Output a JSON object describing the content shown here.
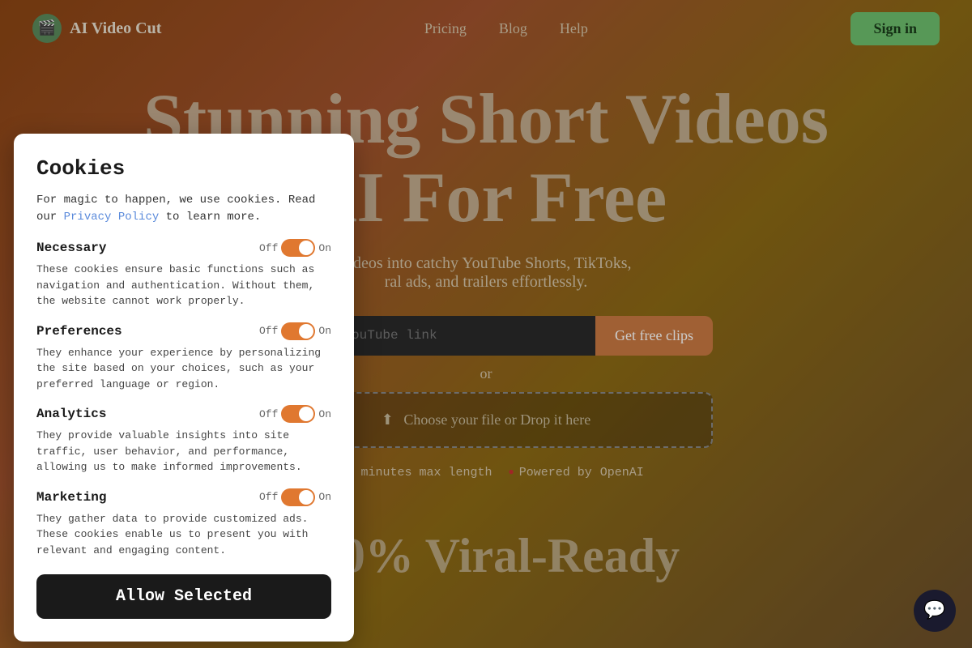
{
  "navbar": {
    "logo_icon": "🎬",
    "logo_text": "AI Video Cut",
    "nav_items": [
      {
        "label": "Pricing",
        "id": "pricing"
      },
      {
        "label": "Blog",
        "id": "blog"
      },
      {
        "label": "Help",
        "id": "help"
      }
    ],
    "sign_in_label": "Sign in"
  },
  "hero": {
    "title_line1": "Stunning Short Videos",
    "title_line2": "AI For Free",
    "subtitle": "videos into catchy YouTube Shorts, TikToks,",
    "subtitle2": "ral ads, and trailers effortlessly."
  },
  "cta": {
    "input_placeholder": "aste the YouTube link",
    "get_clips_label": "Get free clips",
    "or_label": "or",
    "drop_label": "Choose your file or Drop it here",
    "feature1": "30 minutes max length",
    "feature2": "Powered by",
    "openai_label": "OpenAI"
  },
  "bottom": {
    "hint_text": "100% Viral-Ready"
  },
  "cookie_modal": {
    "title": "Cookies",
    "intro": "For magic to happen, we use cookies. Read our",
    "read_label": "Read",
    "privacy_label": "Privacy Policy",
    "intro_end": "to learn more.",
    "sections": [
      {
        "id": "necessary",
        "title": "Necessary",
        "toggle_off": "Off",
        "toggle_on": "On",
        "description": "These cookies ensure basic functions such as navigation and authentication. Without them, the website cannot work properly."
      },
      {
        "id": "preferences",
        "title": "Preferences",
        "toggle_off": "Off",
        "toggle_on": "On",
        "description": "They enhance your experience by personalizing the site based on your choices, such as your preferred language or region."
      },
      {
        "id": "analytics",
        "title": "Analytics",
        "toggle_off": "Off",
        "toggle_on": "On",
        "description": "They provide valuable insights into site traffic, user behavior, and performance, allowing us to make informed improvements."
      },
      {
        "id": "marketing",
        "title": "Marketing",
        "toggle_off": "Off",
        "toggle_on": "On",
        "description": "They gather data to provide customized ads. These cookies enable us to present you with relevant and engaging content."
      }
    ],
    "allow_selected_label": "Allow Selected"
  }
}
